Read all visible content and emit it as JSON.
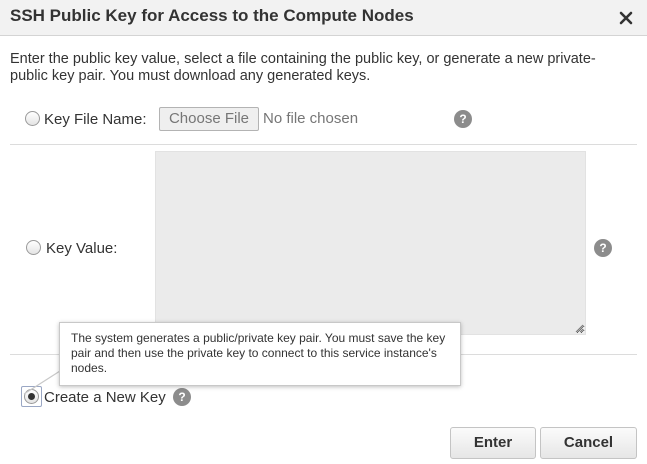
{
  "dialog": {
    "title": "SSH Public Key for Access to the Compute Nodes",
    "close_icon": "close-icon",
    "intro_text": "Enter the public key value, select a file containing the public key, or generate a new private-public key pair. You must download any generated keys."
  },
  "options": {
    "key_file": {
      "label": "Key File Name:",
      "choose_button": "Choose File",
      "file_status": "No file chosen",
      "selected": false
    },
    "key_value": {
      "label": "Key Value:",
      "value": "",
      "selected": false
    },
    "create_key": {
      "label": "Create a New Key",
      "selected": true
    }
  },
  "help_icon_glyph": "?",
  "tooltip": {
    "text": "The system generates a public/private key pair. You must save the key pair and then use the private key to connect to this service instance's nodes."
  },
  "footer": {
    "enter_label": "Enter",
    "cancel_label": "Cancel"
  }
}
